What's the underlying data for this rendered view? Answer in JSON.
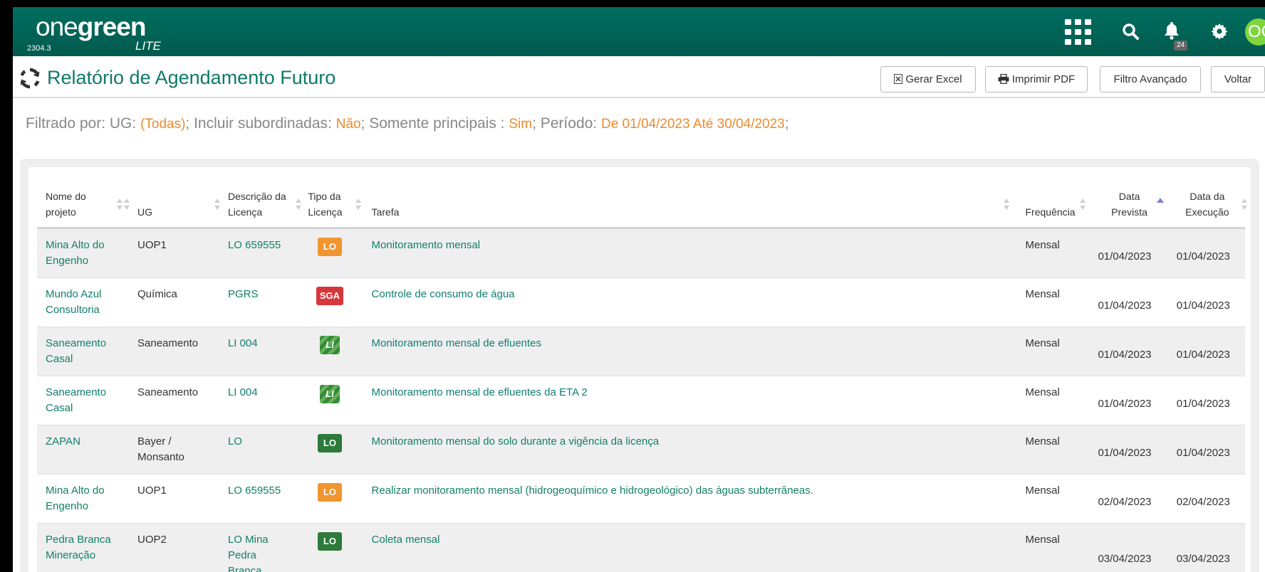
{
  "header": {
    "logo_one": "one",
    "logo_green": "green",
    "logo_lite": "LITE",
    "version": "2304.3",
    "notifications_count": "24",
    "avatar_initials": "OG",
    "icons": [
      "apps-grid-icon",
      "search-icon",
      "bell-icon",
      "gear-icon"
    ],
    "brand_color": "#006e5f"
  },
  "page": {
    "title": "Relatório de Agendamento Futuro",
    "buttons": {
      "excel": "Gerar Excel",
      "pdf": "Imprimir PDF",
      "filter": "Filtro Avançado",
      "back": "Voltar"
    }
  },
  "filter": {
    "prefix": "Filtrado por: UG: ",
    "ug": "(Todas)",
    "sep1": "; Incluir subordinadas: ",
    "subordinadas": "Não",
    "sep2": "; Somente principais : ",
    "principais": "Sim",
    "sep3": "; Período: ",
    "periodo": "De 01/04/2023 Até 30/04/2023",
    "end": ";",
    "highlight_color": "#ee8a2b"
  },
  "table": {
    "columns": {
      "projeto": "Nome do projeto",
      "ug": "UG",
      "descricao": "Descrição da Licença",
      "tipo": "Tipo da Licença",
      "tarefa": "Tarefa",
      "frequencia": "Frequência",
      "data_prevista": "Data Prevista",
      "data_execucao": "Data da Execução"
    },
    "sorted_column": "data_prevista",
    "sort_direction": "ascending",
    "rows": [
      {
        "projeto": "Mina Alto do Engenho",
        "ug": "UOP1",
        "descricao": "LO 659555",
        "tipo": "LO",
        "tipo_color": "orange",
        "tarefa": "Monitoramento mensal",
        "frequencia": "Mensal",
        "data_prevista": "01/04/2023",
        "data_execucao": "01/04/2023"
      },
      {
        "projeto": "Mundo Azul Consultoria",
        "ug": "Química",
        "descricao": "PGRS",
        "tipo": "SGA",
        "tipo_color": "red",
        "tarefa": "Controle de consumo de água",
        "frequencia": "Mensal",
        "data_prevista": "01/04/2023",
        "data_execucao": "01/04/2023"
      },
      {
        "projeto": "Saneamento Casal",
        "ug": "Saneamento",
        "descricao": "LI 004",
        "tipo": "LI",
        "tipo_color": "green-striped",
        "tarefa": "Monitoramento mensal de efluentes",
        "frequencia": "Mensal",
        "data_prevista": "01/04/2023",
        "data_execucao": "01/04/2023"
      },
      {
        "projeto": "Saneamento Casal",
        "ug": "Saneamento",
        "descricao": "LI 004",
        "tipo": "LI",
        "tipo_color": "green-striped",
        "tarefa": "Monitoramento mensal de efluentes da ETA 2",
        "frequencia": "Mensal",
        "data_prevista": "01/04/2023",
        "data_execucao": "01/04/2023"
      },
      {
        "projeto": "ZAPAN",
        "ug": "Bayer / Monsanto",
        "descricao": "LO",
        "tipo": "LO",
        "tipo_color": "green",
        "tarefa": "Monitoramento mensal do solo durante a vigência da licença",
        "frequencia": "Mensal",
        "data_prevista": "01/04/2023",
        "data_execucao": "01/04/2023"
      },
      {
        "projeto": "Mina Alto do Engenho",
        "ug": "UOP1",
        "descricao": "LO 659555",
        "tipo": "LO",
        "tipo_color": "orange",
        "tarefa": "Realizar monitoramento mensal (hidrogeoquímico e hidrogeológico) das águas subterrâneas.",
        "frequencia": "Mensal",
        "data_prevista": "02/04/2023",
        "data_execucao": "02/04/2023"
      },
      {
        "projeto": "Pedra Branca Mineração",
        "ug": "UOP2",
        "descricao": "LO Mina Pedra Branca",
        "tipo": "LO",
        "tipo_color": "green",
        "tarefa": "Coleta mensal",
        "frequencia": "Mensal",
        "data_prevista": "03/04/2023",
        "data_execucao": "03/04/2023"
      }
    ]
  }
}
